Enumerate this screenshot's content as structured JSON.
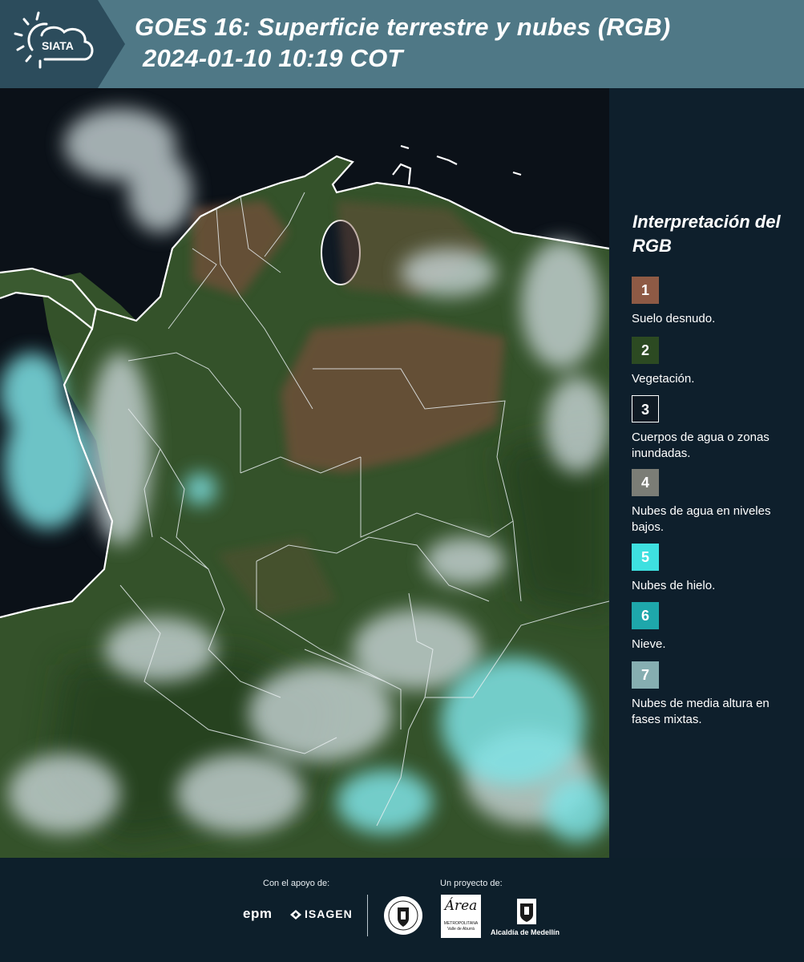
{
  "header": {
    "logo_text": "SIATA",
    "title_line1": "GOES 16: Superficie terrestre y nubes (RGB)",
    "title_line2": "2024-01-10 10:19 COT"
  },
  "legend": {
    "title": "Interpretación del RGB",
    "items": [
      {
        "number": "1",
        "label": "Suelo desnudo.",
        "color": "#8e5a45"
      },
      {
        "number": "2",
        "label": "Vegetación.",
        "color": "#2c4a22"
      },
      {
        "number": "3",
        "label": "Cuerpos de agua o zonas inundadas.",
        "color": "#0f1a24"
      },
      {
        "number": "4",
        "label": "Nubes de agua en niveles bajos.",
        "color": "#7b7d76"
      },
      {
        "number": "5",
        "label": "Nubes de hielo.",
        "color": "#3ee0e0"
      },
      {
        "number": "6",
        "label": "Nieve.",
        "color": "#1ea7ab"
      },
      {
        "number": "7",
        "label": "Nubes de media altura en fases mixtas.",
        "color": "#86aeb1"
      }
    ]
  },
  "footer": {
    "support_label": "Con el apoyo de:",
    "project_label": "Un proyecto de:",
    "epm": "epm",
    "isagen": "ISAGEN",
    "area_script": "Área",
    "area_small": "METROPOLITANA Valle de Aburrá",
    "alcaldia": "Alcaldía de Medellín"
  },
  "colors": {
    "header_bg": "#4f7886",
    "page_bg": "#0d1f2b",
    "ocean": "#0b1118",
    "vegetation": "#34522a",
    "bare_soil": "#74503a",
    "ice_cloud": "#7fe3e6",
    "low_cloud": "#c9d6d8"
  }
}
